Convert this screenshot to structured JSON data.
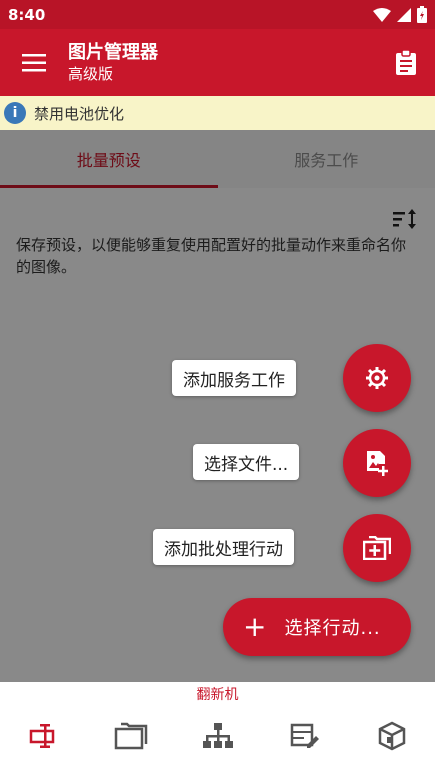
{
  "status_bar": {
    "time": "8:40"
  },
  "app_bar": {
    "title": "图片管理器",
    "subtitle": "高级版"
  },
  "banner": {
    "text": "禁用电池优化"
  },
  "tabs": [
    {
      "label": "批量预设",
      "active": true
    },
    {
      "label": "服务工作",
      "active": false
    }
  ],
  "content": {
    "description": "保存预设，以便能够重复使用配置好的批量动作来重命名你的图像。"
  },
  "speed_dial": [
    {
      "label": "添加服务工作",
      "icon": "gear-sparkle-icon"
    },
    {
      "label": "选择文件...",
      "icon": "add-image-icon"
    },
    {
      "label": "添加批处理行动",
      "icon": "add-folder-icon"
    }
  ],
  "main_fab": {
    "label": "选择行动..."
  },
  "bottom_nav": {
    "active_label": "翻新机",
    "items": [
      {
        "icon": "rename-icon",
        "active": true
      },
      {
        "icon": "folder-icon",
        "active": false
      },
      {
        "icon": "hierarchy-icon",
        "active": false
      },
      {
        "icon": "edit-list-icon",
        "active": false
      },
      {
        "icon": "cube-icon",
        "active": false
      }
    ]
  },
  "colors": {
    "primary": "#c8172b",
    "status_bar": "#b81427",
    "banner_bg": "#f8f4c8",
    "info_icon": "#3a78b8"
  }
}
